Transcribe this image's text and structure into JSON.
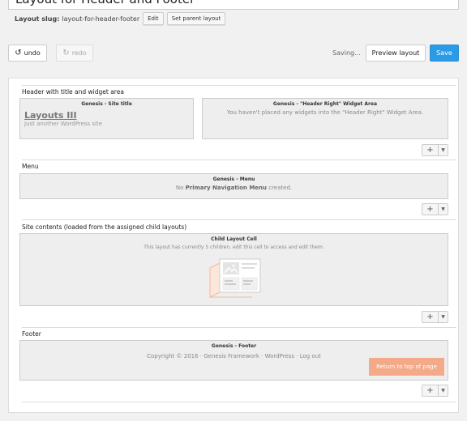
{
  "layout": {
    "title": "Layout for Header and Footer",
    "slug_label": "Layout slug:",
    "slug_value": "layout-for-header-footer",
    "edit_label": "Edit",
    "set_parent_label": "Set parent layout"
  },
  "toolbar": {
    "undo_label": "undo",
    "redo_label": "redo",
    "status": "Saving...",
    "preview_label": "Preview layout",
    "save_label": "Save"
  },
  "rows": {
    "header": {
      "title": "Header with title and widget area",
      "site_cell_title": "Genesis - Site title",
      "site_name": "Layouts III",
      "site_tagline": "Just another WordPress site",
      "widget_cell_title": "Genesis - \"Header Right\" Widget Area",
      "widget_cell_text": "You haven't placed any widgets into the \"Header Right\" Widget Area."
    },
    "menu": {
      "title": "Menu",
      "cell_title": "Genesis - Menu",
      "text_before": "No ",
      "text_bold": "Primary Navigation Menu",
      "text_after": " created."
    },
    "contents": {
      "title": "Site contents (loaded from the assigned child layouts)",
      "cell_title": "Child Layout Cell",
      "cell_text": "This layout has currently 5 children, edit this cell to access and edit them."
    },
    "footer": {
      "title": "Footer",
      "cell_title": "Genesis - Footer",
      "cell_text": "Copyright © 2016 · Genesis Framework · WordPress · Log out",
      "return_label": "Return to top of page"
    }
  },
  "controls": {
    "add_symbol": "+",
    "caret_symbol": "▼"
  },
  "colors": {
    "accent": "#2a9be6",
    "return_button": "#f4a989",
    "illustration": "#f0b89a"
  }
}
